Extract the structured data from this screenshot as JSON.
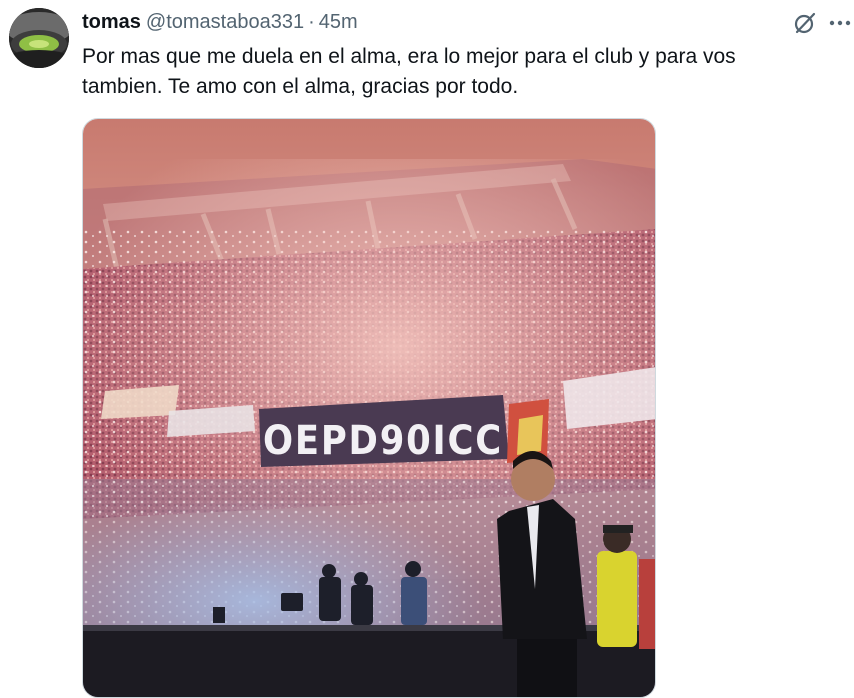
{
  "tweet": {
    "author_name": "tomas",
    "handle": "@tomastaboa331",
    "separator": "·",
    "time": "45m",
    "text_line1": "Por mas que me duela en el alma, era lo mejor para el club y para vos",
    "text_line2": "tambien. Te amo con el alma, gracias por todo.",
    "image_banner_text": "OEPD90ICC",
    "image_alt": "Stadium full of fans with lights and a man in a suit standing on the field"
  },
  "icons": {
    "grok": "grok-icon",
    "more": "more-icon",
    "avatar": "avatar-image"
  },
  "colors": {
    "text": "#0f1419",
    "secondary": "#536471",
    "border": "#cfd9de"
  }
}
